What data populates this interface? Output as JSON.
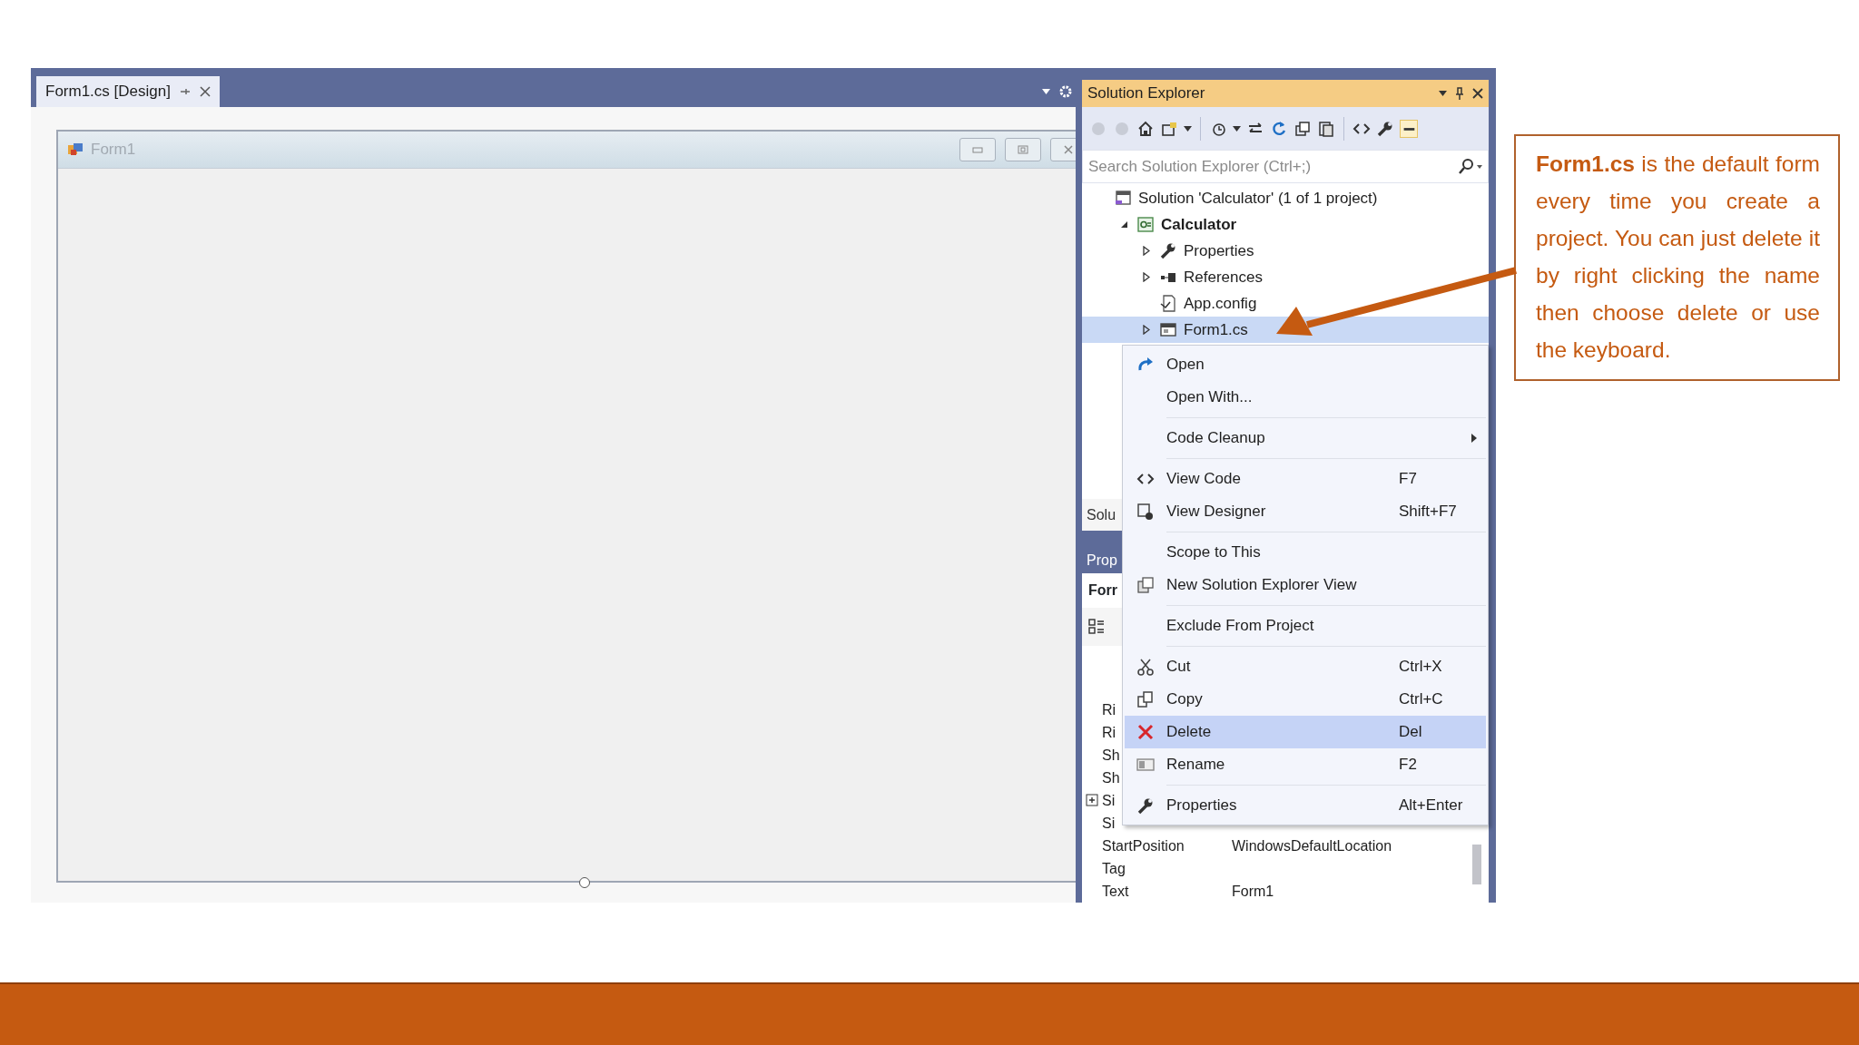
{
  "designer": {
    "tabs": [
      {
        "label": "Form1.cs [Design]",
        "selected": true
      }
    ],
    "form": {
      "title": "Form1"
    }
  },
  "solution_explorer": {
    "title": "Solution Explorer",
    "search": {
      "placeholder": "Search Solution Explorer (Ctrl+;)"
    },
    "tree": [
      {
        "label": "Solution 'Calculator' (1 of 1 project)",
        "kind": "solution",
        "selected": false,
        "children": [
          {
            "label": "Calculator",
            "kind": "project",
            "selected": false,
            "expanded": true,
            "children": [
              {
                "label": "Properties",
                "kind": "properties",
                "selected": false,
                "expanded": false
              },
              {
                "label": "References",
                "kind": "references",
                "selected": false,
                "expanded": false
              },
              {
                "label": "App.config",
                "kind": "config",
                "selected": false
              },
              {
                "label": "Form1.cs",
                "kind": "form",
                "selected": true,
                "expanded": false
              }
            ]
          }
        ]
      }
    ],
    "bottom_tab": "Solu"
  },
  "properties": {
    "title": "Prop",
    "object": "Forr",
    "rows": [
      {
        "name": "Ri"
      },
      {
        "name": "Ri"
      },
      {
        "name": "Sh"
      },
      {
        "name": "Sh"
      },
      {
        "name": "Si",
        "expanded": false
      },
      {
        "name": "Si"
      },
      {
        "name": "StartPosition",
        "value": "WindowsDefaultLocation"
      },
      {
        "name": "Tag"
      },
      {
        "name": "Text",
        "value": "Form1"
      }
    ]
  },
  "context_menu": [
    {
      "kind": "item",
      "label": "Open",
      "selected": false,
      "submenu": false
    },
    {
      "kind": "item",
      "label": "Open With...",
      "selected": false,
      "submenu": false
    },
    {
      "kind": "separator"
    },
    {
      "kind": "item",
      "label": "Code Cleanup",
      "selected": false,
      "submenu": true
    },
    {
      "kind": "separator"
    },
    {
      "kind": "item",
      "label": "View Code",
      "shortcut": "F7",
      "selected": false,
      "submenu": false
    },
    {
      "kind": "item",
      "label": "View Designer",
      "shortcut": "Shift+F7",
      "selected": false,
      "submenu": false
    },
    {
      "kind": "separator"
    },
    {
      "kind": "item",
      "label": "Scope to This",
      "selected": false,
      "submenu": false
    },
    {
      "kind": "item",
      "label": "New Solution Explorer View",
      "selected": false,
      "submenu": false
    },
    {
      "kind": "separator"
    },
    {
      "kind": "item",
      "label": "Exclude From Project",
      "selected": false,
      "submenu": false
    },
    {
      "kind": "separator"
    },
    {
      "kind": "item",
      "label": "Cut",
      "shortcut": "Ctrl+X",
      "selected": false,
      "submenu": false
    },
    {
      "kind": "item",
      "label": "Copy",
      "shortcut": "Ctrl+C",
      "selected": false,
      "submenu": false
    },
    {
      "kind": "item",
      "label": "Delete",
      "shortcut": "Del",
      "selected": true,
      "submenu": false
    },
    {
      "kind": "item",
      "label": "Rename",
      "shortcut": "F2",
      "selected": false,
      "submenu": false
    },
    {
      "kind": "separator"
    },
    {
      "kind": "item",
      "label": "Properties",
      "shortcut": "Alt+Enter",
      "selected": false,
      "submenu": false
    }
  ],
  "annotation": "**Form1.cs** is the default form every time you create a project. You can just delete it by right clicking the name then choose delete or use the keyboard."
}
